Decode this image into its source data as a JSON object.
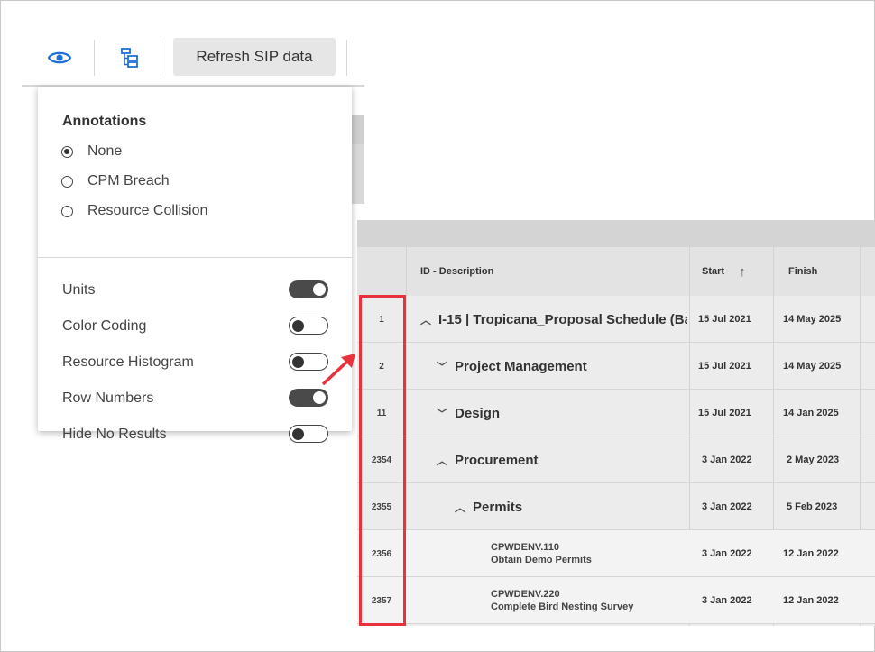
{
  "toolbar": {
    "icons": [
      "eye-icon",
      "hierarchy-icon"
    ],
    "refresh_label": "Refresh SIP data"
  },
  "panel": {
    "annotations_title": "Annotations",
    "annotations": [
      {
        "label": "None",
        "selected": true
      },
      {
        "label": "CPM Breach",
        "selected": false
      },
      {
        "label": "Resource Collision",
        "selected": false
      }
    ],
    "toggles": [
      {
        "label": "Units",
        "on": true
      },
      {
        "label": "Color Coding",
        "on": false
      },
      {
        "label": "Resource Histogram",
        "on": false
      },
      {
        "label": "Row Numbers",
        "on": true
      },
      {
        "label": "Hide No Results",
        "on": false
      }
    ]
  },
  "table": {
    "headers": {
      "description": "ID - Description",
      "start": "Start",
      "start_sort_icon": "arrow-up-icon",
      "finish": "Finish"
    },
    "rows": [
      {
        "num": "1",
        "chevron": "^",
        "description": "I-15 | Tropicana_Proposal Schedule (Ba",
        "start": "15 Jul 2021",
        "finish": "14 May 2025"
      },
      {
        "num": "2",
        "chevron": "v",
        "description": "Project Management",
        "start": "15 Jul 2021",
        "finish": "14 May 2025"
      },
      {
        "num": "11",
        "chevron": "v",
        "description": "Design",
        "start": "15 Jul 2021",
        "finish": "14 Jan 2025"
      },
      {
        "num": "2354",
        "chevron": "^",
        "description": "Procurement",
        "start": "3 Jan 2022",
        "finish": "2 May 2023"
      },
      {
        "num": "2355",
        "chevron": "^",
        "description": "Permits",
        "start": "3 Jan 2022",
        "finish": "5 Feb 2023"
      },
      {
        "num": "2356",
        "code": "CPWDENV.110",
        "description": "Obtain Demo Permits",
        "start": "3 Jan 2022",
        "finish": "12 Jan 2022"
      },
      {
        "num": "2357",
        "code": "CPWDENV.220",
        "description": "Complete Bird Nesting Survey",
        "start": "3 Jan 2022",
        "finish": "12 Jan 2022"
      }
    ]
  },
  "colors": {
    "highlight": "#e8323c",
    "accent": "#1e6fd9"
  }
}
